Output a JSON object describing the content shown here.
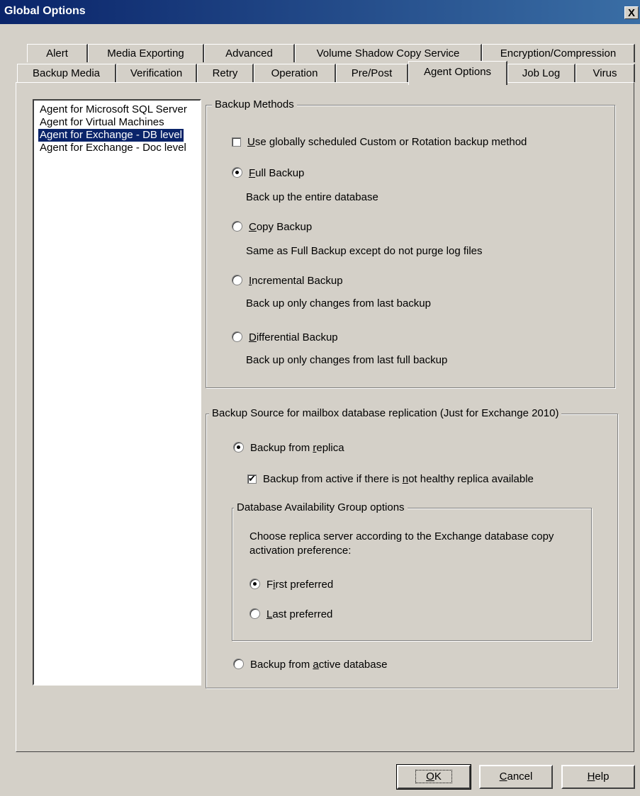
{
  "window": {
    "title": "Global Options",
    "close_glyph": "X"
  },
  "tabs_row1": [
    "Alert",
    "Media Exporting",
    "Advanced",
    "Volume Shadow Copy Service",
    "Encryption/Compression"
  ],
  "tabs_row2": [
    "Backup Media",
    "Verification",
    "Retry",
    "Operation",
    "Pre/Post",
    "Agent Options",
    "Job Log",
    "Virus"
  ],
  "active_tab": "Agent Options",
  "agent_list": [
    "Agent for Microsoft SQL Server",
    "Agent for Virtual Machines",
    "Agent for Exchange - DB level",
    "Agent for Exchange - Doc level"
  ],
  "selected_agent": "Agent for Exchange - DB level",
  "backup_methods": {
    "legend": "Backup Methods",
    "use_global": {
      "pre": "",
      "u": "U",
      "post": "se globally scheduled Custom or Rotation backup method",
      "checked": false
    },
    "full": {
      "u": "F",
      "post": "ull Backup",
      "desc": "Back up the entire database",
      "checked": true
    },
    "copy": {
      "u": "C",
      "post": "opy Backup",
      "desc": "Same as Full Backup except do not purge log files",
      "checked": false
    },
    "incremental": {
      "u": "I",
      "post": "ncremental Backup",
      "desc": "Back up only changes from last backup",
      "checked": false
    },
    "differential": {
      "u": "D",
      "post": "ifferential Backup",
      "desc": "Back up only changes from last full backup",
      "checked": false
    }
  },
  "backup_source": {
    "legend": "Backup Source for mailbox database replication (Just for Exchange 2010)",
    "from_replica": {
      "pre": "Backup from ",
      "u": "r",
      "post": "eplica",
      "checked": true
    },
    "from_active_fallback": {
      "pre": "Backup from active if there is ",
      "u": "n",
      "post": "ot healthy replica available",
      "checked": true
    },
    "dag": {
      "legend": "Database Availability Group options",
      "desc_line1": "Choose replica server according to the Exchange database copy",
      "desc_line2": "activation preference:",
      "first": {
        "pre": "F",
        "u": "i",
        "post": "rst preferred",
        "checked": true
      },
      "last": {
        "pre": "",
        "u": "L",
        "post": "ast preferred",
        "checked": false
      }
    },
    "from_active_db": {
      "pre": "Backup from ",
      "u": "a",
      "post": "ctive database",
      "checked": false
    }
  },
  "buttons": {
    "ok": {
      "u": "O",
      "post": "K"
    },
    "cancel": {
      "u": "C",
      "post": "ancel"
    },
    "help": {
      "u": "H",
      "post": "elp"
    }
  },
  "colors": {
    "face": "#d4d0c8",
    "title_bar": "#0a246a",
    "selection": "#0a246a"
  }
}
